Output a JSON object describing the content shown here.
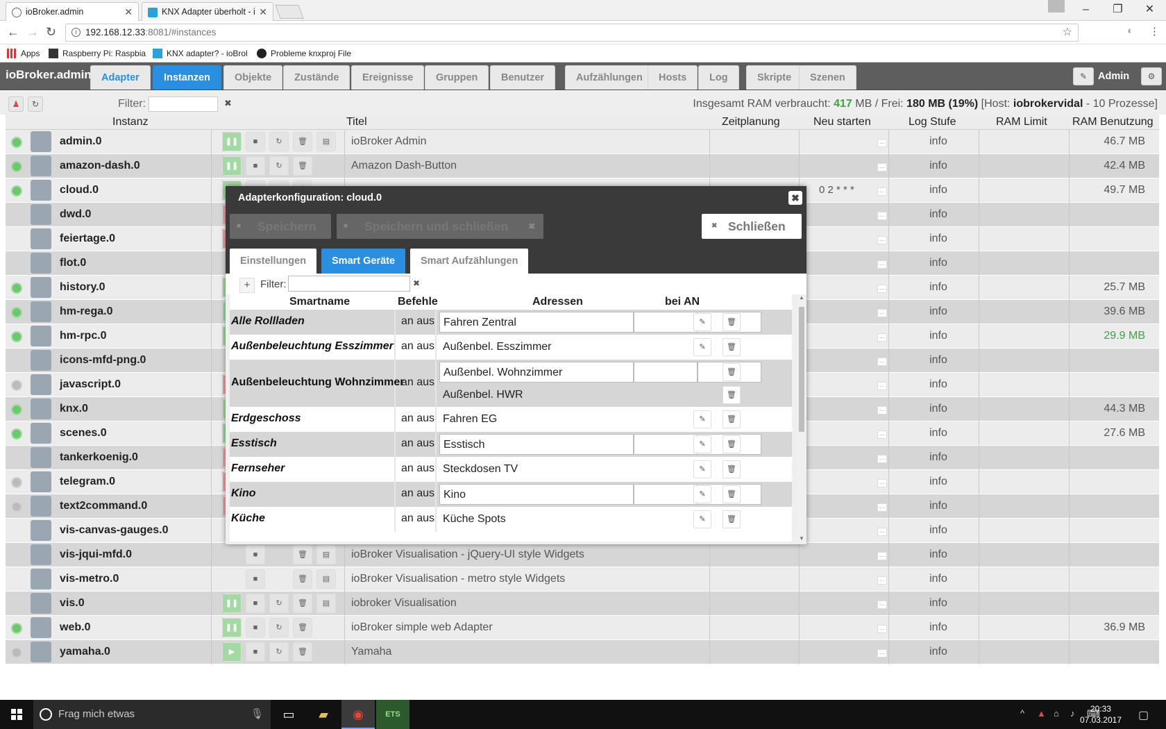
{
  "browser": {
    "tabs": [
      {
        "label": "ioBroker.admin",
        "active": true
      },
      {
        "label": "KNX Adapter überholt - i",
        "active": false
      }
    ],
    "url_host": "192.168.12.33",
    "url_rest": ":8081/#instances",
    "bookmarks": [
      "Apps",
      "Raspberry Pi: Raspbia",
      "KNX adapter? - ioBrol",
      "Probleme knxproj File"
    ],
    "window_buttons": [
      "–",
      "❐",
      "✕"
    ]
  },
  "app": {
    "brand": "ioBroker.admin",
    "nav_tabs": [
      "Adapter",
      "Instanzen",
      "Objekte",
      "Zustände",
      "Ereignisse",
      "Gruppen",
      "Benutzer",
      "Aufzählungen",
      "Hosts",
      "Log",
      "Skripte",
      "Szenen"
    ],
    "active_tab": "Instanzen",
    "user": "Admin"
  },
  "toolbar": {
    "filter_label": "Filter:",
    "ram_prefix": "Insgesamt RAM verbraucht: ",
    "ram_used": "417",
    "ram_mid": " MB / Frei: ",
    "ram_free": "180",
    "ram_unit": " MB (19%)",
    "ram_host_prefix": " [Host: ",
    "ram_host": "iobrokervidal",
    "ram_suffix": " - 10 Prozesse]"
  },
  "table": {
    "headers": [
      "Instanz",
      "Titel",
      "Zeitplanung",
      "Neu starten",
      "Log Stufe",
      "RAM Limit",
      "RAM Benutzung"
    ],
    "rows": [
      {
        "name": "admin.0",
        "status": "on",
        "icon": "gear-icon",
        "title": "ioBroker Admin",
        "cron": "",
        "log": "info",
        "ram": "46.7 MB",
        "ctl": "run"
      },
      {
        "name": "amazon-dash.0",
        "status": "on",
        "icon": "amazon-icon",
        "title": "Amazon Dash-Button",
        "cron": "",
        "log": "info",
        "ram": "42.4 MB",
        "ctl": "run"
      },
      {
        "name": "cloud.0",
        "status": "on",
        "icon": "cloud-icon",
        "title": "",
        "cron": "0 2 * * *",
        "log": "info",
        "ram": "49.7 MB",
        "ctl": "run"
      },
      {
        "name": "dwd.0",
        "status": "none",
        "icon": "weather-icon",
        "title": "",
        "cron": "",
        "log": "info",
        "ram": "",
        "ctl": "stop"
      },
      {
        "name": "feiertage.0",
        "status": "none",
        "icon": "calendar-icon",
        "title": "",
        "cron": "",
        "log": "info",
        "ram": "",
        "ctl": "stop"
      },
      {
        "name": "flot.0",
        "status": "none",
        "icon": "flot-icon",
        "title": "",
        "cron": "",
        "log": "info",
        "ram": "",
        "ctl": "none"
      },
      {
        "name": "history.0",
        "status": "on",
        "icon": "clock-icon",
        "title": "",
        "cron": "",
        "log": "info",
        "ram": "25.7 MB",
        "ctl": "run"
      },
      {
        "name": "hm-rega.0",
        "status": "on",
        "icon": "homematic-icon",
        "title": "",
        "cron": "",
        "log": "info",
        "ram": "39.6 MB",
        "ctl": "run"
      },
      {
        "name": "hm-rpc.0",
        "status": "on",
        "icon": "homematic-icon",
        "title": "",
        "cron": "",
        "log": "info",
        "ram": "29.9 MB",
        "ramGreen": true,
        "ctl": "run"
      },
      {
        "name": "icons-mfd-png.0",
        "status": "none",
        "icon": "house-icon",
        "title": "",
        "cron": "",
        "log": "info",
        "ram": "",
        "ctl": "none"
      },
      {
        "name": "javascript.0",
        "status": "off",
        "icon": "js-icon",
        "title": "",
        "cron": "",
        "log": "info",
        "ram": "",
        "ctl": "stop"
      },
      {
        "name": "knx.0",
        "status": "on",
        "icon": "knx-icon",
        "title": "",
        "cron": "",
        "log": "info",
        "ram": "44.3 MB",
        "ctl": "run"
      },
      {
        "name": "scenes.0",
        "status": "on",
        "icon": "clapper-icon",
        "title": "",
        "cron": "",
        "log": "info",
        "ram": "27.6 MB",
        "ctl": "run"
      },
      {
        "name": "tankerkoenig.0",
        "status": "none",
        "icon": "fuel-icon",
        "title": "",
        "cron": "",
        "log": "info",
        "ram": "",
        "ctl": "stop"
      },
      {
        "name": "telegram.0",
        "status": "off",
        "icon": "telegram-icon",
        "title": "",
        "cron": "",
        "log": "info",
        "ram": "",
        "ctl": "stop"
      },
      {
        "name": "text2command.0",
        "status": "off",
        "icon": "brain-icon",
        "title": "",
        "cron": "",
        "log": "info",
        "ram": "",
        "ctl": "stop"
      },
      {
        "name": "vis-canvas-gauges.0",
        "status": "none",
        "icon": "gauge-icon",
        "title": "",
        "cron": "",
        "log": "info",
        "ram": "",
        "ctl": "none"
      },
      {
        "name": "vis-jqui-mfd.0",
        "status": "none",
        "icon": "widget-icon",
        "title": "ioBroker Visualisation - jQuery-UI style Widgets",
        "cron": "",
        "log": "info",
        "ram": "",
        "ctl": "none"
      },
      {
        "name": "vis-metro.0",
        "status": "none",
        "icon": "metro-icon",
        "title": "ioBroker Visualisation - metro style Widgets",
        "cron": "",
        "log": "info",
        "ram": "",
        "ctl": "none"
      },
      {
        "name": "vis.0",
        "status": "none",
        "icon": "vis-icon",
        "title": "iobroker Visualisation",
        "cron": "",
        "log": "info",
        "ram": "",
        "ctl": "run"
      },
      {
        "name": "web.0",
        "status": "on",
        "icon": "www-icon",
        "title": "ioBroker simple web Adapter",
        "cron": "",
        "log": "info",
        "ram": "36.9 MB",
        "ctl": "run"
      },
      {
        "name": "yamaha.0",
        "status": "off",
        "icon": "yamaha-icon",
        "title": "Yamaha",
        "cron": "",
        "log": "info",
        "ram": "",
        "ctl": "play"
      }
    ]
  },
  "dialog": {
    "title": "Adapterkonfiguration: cloud.0",
    "save": "Speichern",
    "save_close": "Speichern und schließen",
    "close": "Schließen",
    "tabs": [
      "Einstellungen",
      "Smart Geräte",
      "Smart Aufzählungen"
    ],
    "active_tab": "Smart Geräte",
    "filter_label": "Filter:",
    "headers": [
      "Smartname",
      "Befehle",
      "Adressen",
      "bei AN"
    ],
    "devices": [
      {
        "name": "Alle Rollladen",
        "cmd": "an aus",
        "addr": [
          "Fahren Zentral"
        ],
        "shade": true,
        "box": true
      },
      {
        "name": "Außenbeleuchtung Esszimmer",
        "cmd": "an aus",
        "addr": [
          "Außenbel. Esszimmer"
        ],
        "shade": false,
        "box": false
      },
      {
        "name": "Außenbeleuchtung Wohnzimmer",
        "cmd": "an aus",
        "addr": [
          "Außenbel. Wohnzimmer",
          "Außenbel. HWR"
        ],
        "shade": true,
        "box": true,
        "upright": true
      },
      {
        "name": "Erdgeschoss",
        "cmd": "an aus",
        "addr": [
          "Fahren EG"
        ],
        "shade": false,
        "box": false
      },
      {
        "name": "Esstisch",
        "cmd": "an aus",
        "addr": [
          "Esstisch"
        ],
        "shade": true,
        "box": true
      },
      {
        "name": "Fernseher",
        "cmd": "an aus",
        "addr": [
          "Steckdosen TV"
        ],
        "shade": false,
        "box": false
      },
      {
        "name": "Kino",
        "cmd": "an aus",
        "addr": [
          "Kino"
        ],
        "shade": true,
        "box": true
      },
      {
        "name": "Küche",
        "cmd": "an aus",
        "addr": [
          "Küche Spots"
        ],
        "shade": false,
        "box": false
      }
    ]
  },
  "taskbar": {
    "search_placeholder": "Frag mich etwas",
    "time": "20:33",
    "date": "07.03.2017"
  }
}
